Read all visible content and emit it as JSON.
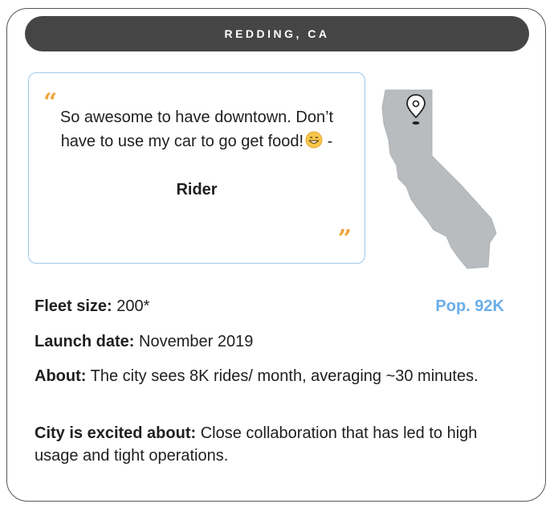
{
  "city": {
    "banner_label": "REDDING, CA"
  },
  "quote": {
    "text": "So awesome to have downtown. Don’t have to use my car to go get food!",
    "dash": " -",
    "author": "Rider",
    "open_mark": "“",
    "close_mark": "”",
    "emoji_icon": "grinning-face-emoji"
  },
  "map": {
    "state": "California",
    "marker_icon": "location-pin-icon",
    "fill_color": "#b9bcbf"
  },
  "stats": {
    "fleet_label": "Fleet size:",
    "fleet_value": " 200*",
    "population": "Pop. 92K",
    "launch_label": "Launch date:",
    "launch_value": " November 2019",
    "about_label": "About:",
    "about_value": " The city sees 8K rides/ month, averaging ~30 minutes.",
    "excited_label": "City is excited about:",
    "excited_value": " Close collaboration that has led to high usage and tight operations."
  },
  "colors": {
    "banner_bg": "#454545",
    "quote_border": "#9cc9ec",
    "quote_marks": "#f0a43a",
    "population_text": "#6aaee8"
  }
}
